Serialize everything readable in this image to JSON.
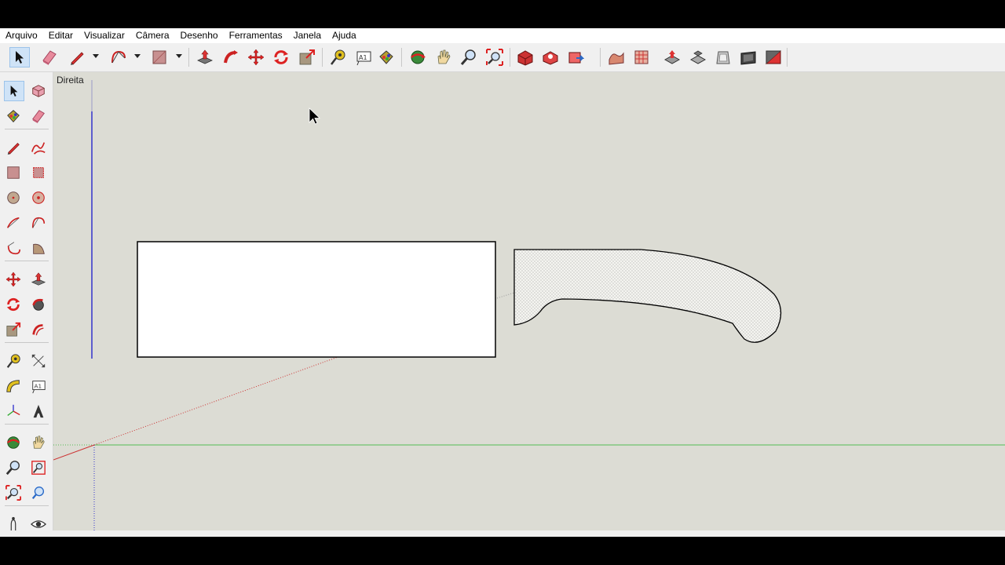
{
  "menu": {
    "items": [
      "Arquivo",
      "Editar",
      "Visualizar",
      "Câmera",
      "Desenho",
      "Ferramentas",
      "Janela",
      "Ajuda"
    ]
  },
  "toolbar": {
    "tools": [
      "select-icon",
      "eraser-icon",
      "pencil-icon",
      "arc-icon",
      "rectangle-icon",
      "push-pull-icon",
      "follow-me-icon",
      "move-icon",
      "rotate-icon",
      "scale-icon",
      "tape-measure-icon",
      "text-icon",
      "paint-bucket-icon",
      "orbit-icon",
      "pan-icon",
      "zoom-icon",
      "zoom-extents-icon",
      "warehouse-icon",
      "share-model-icon",
      "extension-warehouse-icon",
      "sandbox-smoove-icon",
      "sandbox-grid-icon",
      "sandbox-stamp-icon",
      "sandbox-drape-icon",
      "sandbox-detail-icon",
      "sandbox-flip-icon",
      "sandbox-edge-icon"
    ]
  },
  "viewport": {
    "view_name": "Direita"
  },
  "colors": {
    "axis_red": "#cc3333",
    "axis_green": "#44bb44",
    "axis_blue": "#3333cc",
    "background": "#dcdcd4",
    "selection_active": "#cfe3f7"
  }
}
